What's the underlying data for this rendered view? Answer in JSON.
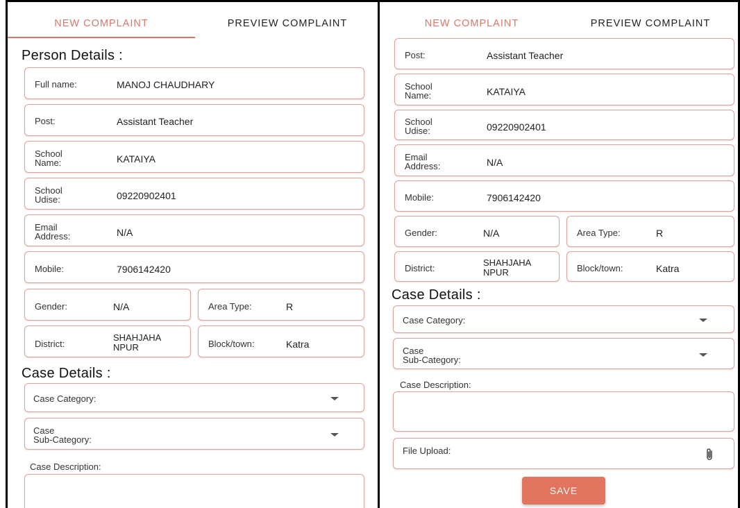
{
  "tabs": {
    "new": "NEW COMPLAINT",
    "preview": "PREVIEW COMPLAINT"
  },
  "sections": {
    "person": "Person Details :",
    "case": "Case Details :"
  },
  "person": {
    "full_name": {
      "label": "Full name:",
      "value": "MANOJ CHAUDHARY"
    },
    "post": {
      "label": "Post:",
      "value": "Assistant Teacher"
    },
    "school_name": {
      "label": "School\nName:",
      "value": "KATAIYA"
    },
    "school_udise": {
      "label": "School\nUdise:",
      "value": "09220902401"
    },
    "email": {
      "label": "Email\nAddress:",
      "value": "N/A"
    },
    "mobile": {
      "label": "Mobile:",
      "value": "7906142420"
    },
    "gender": {
      "label": "Gender:",
      "value": "N/A"
    },
    "area_type": {
      "label": "Area Type:",
      "value": "R"
    },
    "district": {
      "label": "District:",
      "value": "SHAHJAHA\nNPUR"
    },
    "block": {
      "label": "Block/town:",
      "value": "Katra"
    }
  },
  "case": {
    "category_label": "Case Category:",
    "subcategory_label": "Case\nSub-Category:",
    "description_label": "Case Description:",
    "file_upload_label": "File Upload:"
  },
  "save_label": "SAVE",
  "colors": {
    "accent": "#d9776a",
    "border": "#e3a097",
    "button": "#e0745f"
  },
  "icons": {
    "dropdown": "caret-down-icon",
    "attach": "paperclip-icon"
  }
}
